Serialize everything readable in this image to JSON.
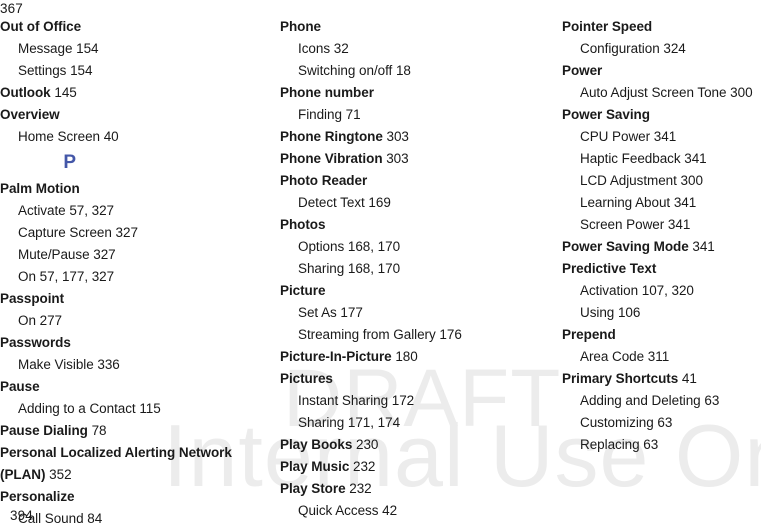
{
  "document": {
    "type": "index",
    "folio_top": "367",
    "folio_bottom": "394",
    "letter_divider": "P",
    "letter_divider_color": "#4457a8"
  },
  "watermark": {
    "line1": "DRAFT",
    "line2": "Internal Use Only",
    "color": "#ececec"
  },
  "columns": [
    {
      "id": "column-1",
      "entries": [
        {
          "level": "main",
          "label": "Out of Office",
          "pages": ""
        },
        {
          "level": "sub",
          "label": "Message",
          "pages": "154"
        },
        {
          "level": "sub",
          "label": "Settings",
          "pages": "154"
        },
        {
          "level": "main",
          "label": "Outlook",
          "pages": "145"
        },
        {
          "level": "main",
          "label": "Overview",
          "pages": ""
        },
        {
          "level": "sub",
          "label": "Home Screen",
          "pages": "40"
        },
        {
          "level": "divider",
          "label": "P",
          "pages": ""
        },
        {
          "level": "main",
          "label": "Palm Motion",
          "pages": ""
        },
        {
          "level": "sub",
          "label": "Activate",
          "pages": "57, 327"
        },
        {
          "level": "sub",
          "label": "Capture Screen",
          "pages": "327"
        },
        {
          "level": "sub",
          "label": "Mute/Pause",
          "pages": "327"
        },
        {
          "level": "sub",
          "label": "On",
          "pages": "57, 177, 327"
        },
        {
          "level": "main",
          "label": "Passpoint",
          "pages": ""
        },
        {
          "level": "sub",
          "label": "On",
          "pages": "277"
        },
        {
          "level": "main",
          "label": "Passwords",
          "pages": ""
        },
        {
          "level": "sub",
          "label": "Make Visible",
          "pages": "336"
        },
        {
          "level": "main",
          "label": "Pause",
          "pages": ""
        },
        {
          "level": "sub",
          "label": "Adding to a Contact",
          "pages": "115"
        },
        {
          "level": "main",
          "label": "Pause Dialing",
          "pages": "78"
        },
        {
          "level": "main",
          "label": "Personal Localized Alerting Network",
          "pages": ""
        },
        {
          "level": "main",
          "label": "(PLAN)",
          "pages": "352"
        },
        {
          "level": "main",
          "label": "Personalize",
          "pages": ""
        },
        {
          "level": "sub",
          "label": "Call Sound",
          "pages": "84"
        }
      ]
    },
    {
      "id": "column-2",
      "entries": [
        {
          "level": "main",
          "label": "Phone",
          "pages": ""
        },
        {
          "level": "sub",
          "label": "Icons",
          "pages": "32"
        },
        {
          "level": "sub",
          "label": "Switching on/off",
          "pages": "18"
        },
        {
          "level": "main",
          "label": "Phone number",
          "pages": ""
        },
        {
          "level": "sub",
          "label": "Finding",
          "pages": "71"
        },
        {
          "level": "main",
          "label": "Phone Ringtone",
          "pages": "303"
        },
        {
          "level": "main",
          "label": "Phone Vibration",
          "pages": "303"
        },
        {
          "level": "main",
          "label": "Photo Reader",
          "pages": ""
        },
        {
          "level": "sub",
          "label": "Detect Text",
          "pages": "169"
        },
        {
          "level": "main",
          "label": "Photos",
          "pages": ""
        },
        {
          "level": "sub",
          "label": "Options",
          "pages": "168, 170"
        },
        {
          "level": "sub",
          "label": "Sharing",
          "pages": "168, 170"
        },
        {
          "level": "main",
          "label": "Picture",
          "pages": ""
        },
        {
          "level": "sub",
          "label": "Set As",
          "pages": "177"
        },
        {
          "level": "sub",
          "label": "Streaming from Gallery",
          "pages": "176"
        },
        {
          "level": "main",
          "label": "Picture-In-Picture",
          "pages": "180"
        },
        {
          "level": "main",
          "label": "Pictures",
          "pages": ""
        },
        {
          "level": "sub",
          "label": "Instant Sharing",
          "pages": "172"
        },
        {
          "level": "sub",
          "label": "Sharing",
          "pages": "171, 174"
        },
        {
          "level": "main",
          "label": "Play Books",
          "pages": "230"
        },
        {
          "level": "main",
          "label": "Play Music",
          "pages": "232"
        },
        {
          "level": "main",
          "label": "Play Store",
          "pages": "232"
        },
        {
          "level": "sub",
          "label": "Quick Access",
          "pages": "42"
        }
      ]
    },
    {
      "id": "column-3",
      "entries": [
        {
          "level": "main",
          "label": "Pointer Speed",
          "pages": ""
        },
        {
          "level": "sub",
          "label": "Configuration",
          "pages": "324"
        },
        {
          "level": "main",
          "label": "Power",
          "pages": ""
        },
        {
          "level": "sub",
          "label": "Auto Adjust Screen Tone",
          "pages": "300"
        },
        {
          "level": "main",
          "label": "Power Saving",
          "pages": ""
        },
        {
          "level": "sub",
          "label": "CPU Power",
          "pages": "341"
        },
        {
          "level": "sub",
          "label": "Haptic Feedback",
          "pages": "341"
        },
        {
          "level": "sub",
          "label": "LCD Adjustment",
          "pages": "300"
        },
        {
          "level": "sub",
          "label": "Learning About",
          "pages": "341"
        },
        {
          "level": "sub",
          "label": "Screen Power",
          "pages": "341"
        },
        {
          "level": "main",
          "label": "Power Saving Mode",
          "pages": "341"
        },
        {
          "level": "main",
          "label": "Predictive Text",
          "pages": ""
        },
        {
          "level": "sub",
          "label": "Activation",
          "pages": "107, 320"
        },
        {
          "level": "sub",
          "label": "Using",
          "pages": "106"
        },
        {
          "level": "main",
          "label": "Prepend",
          "pages": ""
        },
        {
          "level": "sub",
          "label": "Area Code",
          "pages": "311"
        },
        {
          "level": "main",
          "label": "Primary Shortcuts",
          "pages": "41"
        },
        {
          "level": "sub",
          "label": "Adding and Deleting",
          "pages": "63"
        },
        {
          "level": "sub",
          "label": "Customizing",
          "pages": "63"
        },
        {
          "level": "sub",
          "label": "Replacing",
          "pages": "63"
        }
      ]
    }
  ]
}
